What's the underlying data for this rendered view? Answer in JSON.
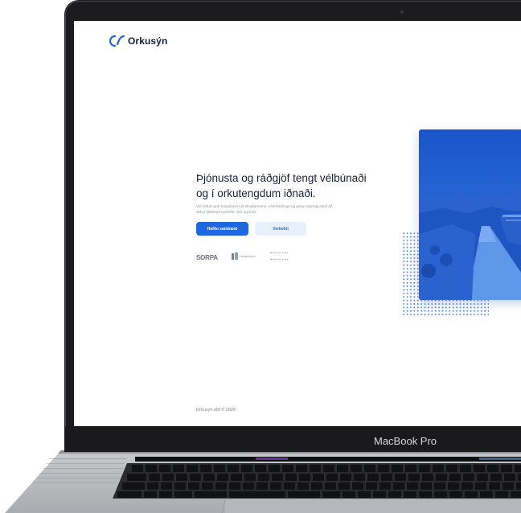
{
  "device": {
    "model_label": "MacBook Pro"
  },
  "site": {
    "logo_text": "Orkusýn",
    "hero": {
      "title_line1": "Þjónusta og ráðgjöf tengt vélbúnaði",
      "title_line2": "og í orkutengdum iðnaði.",
      "subtitle_line1": "Við höfum gott tengslanet við iðnaðarmenn, verkfræðinga og getum þannig tekið að",
      "subtitle_line2": "okkur fjölbreytt verkefni, stór og smá."
    },
    "buttons": {
      "primary": "Hafðu samband",
      "secondary": "Verkefni"
    },
    "partners": {
      "first": "SORPA",
      "second": "Landsvirkjun"
    },
    "footer": "Orkusýn ehf © 2020"
  },
  "colors": {
    "accent": "#1f67e0",
    "accent_light": "#e7f0fd",
    "photo_tint": "#1f5fd1"
  }
}
